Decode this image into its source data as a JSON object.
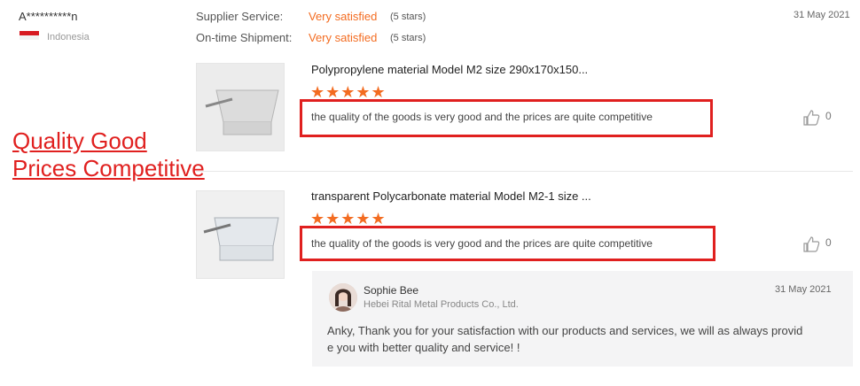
{
  "buyer": {
    "name": "A**********n",
    "country": "Indonesia"
  },
  "ratings": [
    {
      "label": "Supplier Service:",
      "value": "Very satisfied",
      "stars": "(5 stars)"
    },
    {
      "label": "On-time Shipment:",
      "value": "Very satisfied",
      "stars": "(5 stars)"
    }
  ],
  "review_date": "31 May 2021",
  "items": [
    {
      "title": "Polypropylene material Model M2 size 290x170x150...",
      "stars": "★★★★★",
      "review": "the quality of the goods is very good and the prices are quite competitive",
      "likes": "0"
    },
    {
      "title": "transparent Polycarbonate material Model M2-1 size ...",
      "stars": "★★★★★",
      "review": "the quality of the goods is very good and the prices are quite competitive",
      "likes": "0"
    }
  ],
  "annotation": {
    "line1": "Quality Good",
    "line2": "Prices Competitive"
  },
  "reply": {
    "name": "Sophie Bee",
    "company": "Hebei Rital Metal Products Co., Ltd.",
    "date": "31 May 2021",
    "message_line1": "Anky, Thank you for your satisfaction with our products and services, we will as always provid",
    "message_line2": "e you with better quality and service! !"
  },
  "colors": {
    "accent": "#f36c21",
    "highlight": "#e0201f"
  }
}
